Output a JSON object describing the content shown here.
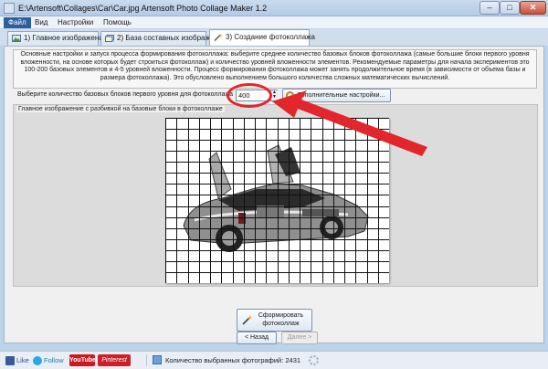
{
  "window": {
    "title": "E:\\Artensoft\\Collages\\Car\\Car.jpg Artensoft Photo Collage Maker 1.2",
    "minimize_glyph": "–",
    "maximize_glyph": "□",
    "close_glyph": "✕"
  },
  "menu": {
    "items": [
      "Файл",
      "Вид",
      "Настройки",
      "Помощь"
    ]
  },
  "tabs": [
    {
      "label": "1) Главное изображение",
      "active": false
    },
    {
      "label": "2) База составных изображений",
      "active": false
    },
    {
      "label": "3) Создание фотоколлажа",
      "active": true
    }
  ],
  "description": "Основные настройки и запуск процесса формирования фотоколлажа: выберите среднее количество базовых блоков фотоколлажа (самые большие блоки первого уровня вложенности, на основе которых будет строиться фотоколлаж) и количество уровней вложенности элементов. Рекомендуемые параметры для начала экспериментов это 100-200 базовых элементов и 4-5 уровней вложенности. Процесс формирования фотоколлажа может занять продолжительное время (в зависимости от объема базы и размера фотоколлажа). Это обусловлено выполнением большого количества сложных математических вычислений.",
  "settings": {
    "count_label": "Выберите количество базовых блоков первого уровня для фотоколлажа",
    "count_value": "400",
    "spin_up": "▲",
    "spin_down": "▼",
    "advanced_button": "Дополнительные настройки..."
  },
  "preview": {
    "group_label": "Главное изображение с разбивкой на базовые блоки в фотоколлаже",
    "grid_columns": 20,
    "grid_rows": 15
  },
  "actions": {
    "form_collage": "Сформировать фотоколлаж",
    "back": "< Назад",
    "next": "Далее >"
  },
  "statusbar": {
    "like": "Like",
    "follow": "Follow",
    "youtube": "YouTube",
    "pinterest": "Pinterest",
    "selected_photos": "Количество выбранных фотографий: 2431"
  },
  "colors": {
    "annotation": "#e2262b",
    "active_menu": "#2b5f9e"
  }
}
